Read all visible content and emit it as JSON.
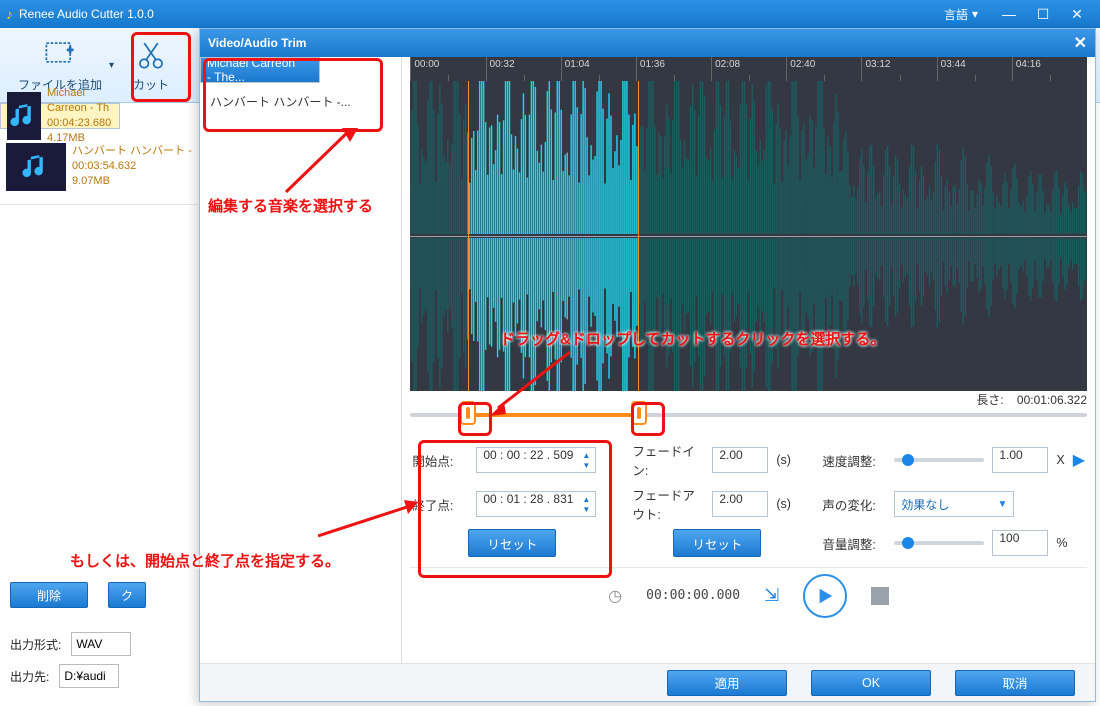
{
  "app": {
    "title": "Renee Audio Cutter 1.0.0",
    "language_label": "言語"
  },
  "toolbar": {
    "add_file": "ファイルを追加",
    "cut": "カット"
  },
  "files": [
    {
      "name": "Michael Carreon - Th",
      "duration": "00:04:23.680",
      "size": "4.17MB"
    },
    {
      "name": "ハンバート ハンバート - ",
      "duration": "00:03:54.632",
      "size": "9.07MB"
    }
  ],
  "main": {
    "delete_btn": "削除",
    "clear_btn": "ク",
    "output_format_label": "出力形式:",
    "output_format_value": "WAV",
    "output_dir_label": "出力先:",
    "output_dir_value": "D:¥audi"
  },
  "dialog": {
    "title": "Video/Audio Trim",
    "tracks": [
      {
        "label": "Michael Carreon - The..."
      },
      {
        "label": "ハンバート ハンバート -..."
      }
    ],
    "ruler_ticks": [
      "00:00",
      "00:32",
      "01:04",
      "01:36",
      "02:08",
      "02:40",
      "03:12",
      "03:44",
      "04:16"
    ],
    "length_label": "長さ:",
    "length_value": "00:01:06.322",
    "start_label": "開始点:",
    "start_value": "00 : 00 : 22 . 509",
    "end_label": "終了点:",
    "end_value": "00 : 01 : 28 . 831",
    "reset_btn": "リセット",
    "fadein_label": "フェードイン:",
    "fadein_value": "2.00",
    "fadeout_label": "フェードアウト:",
    "fadeout_value": "2.00",
    "fade_unit": "(s)",
    "fade_reset": "リセット",
    "speed_label": "速度調整:",
    "speed_value": "1.00",
    "speed_unit": "X",
    "voice_label": "声の変化:",
    "voice_value": "効果なし",
    "volume_label": "音量調整:",
    "volume_value": "100",
    "volume_unit": "%",
    "timecode": "00:00:00.000",
    "apply": "適用",
    "ok": "OK",
    "cancel": "取消"
  },
  "annotations": {
    "select_music": "編集する音楽を選択する",
    "drag_drop": "ドラッグ&ドロップしてカットするクリックを選択する。",
    "or_specify": "もしくは、開始点と終了点を指定する。"
  },
  "selection_pct": {
    "start": 8.5,
    "end": 33.8
  }
}
